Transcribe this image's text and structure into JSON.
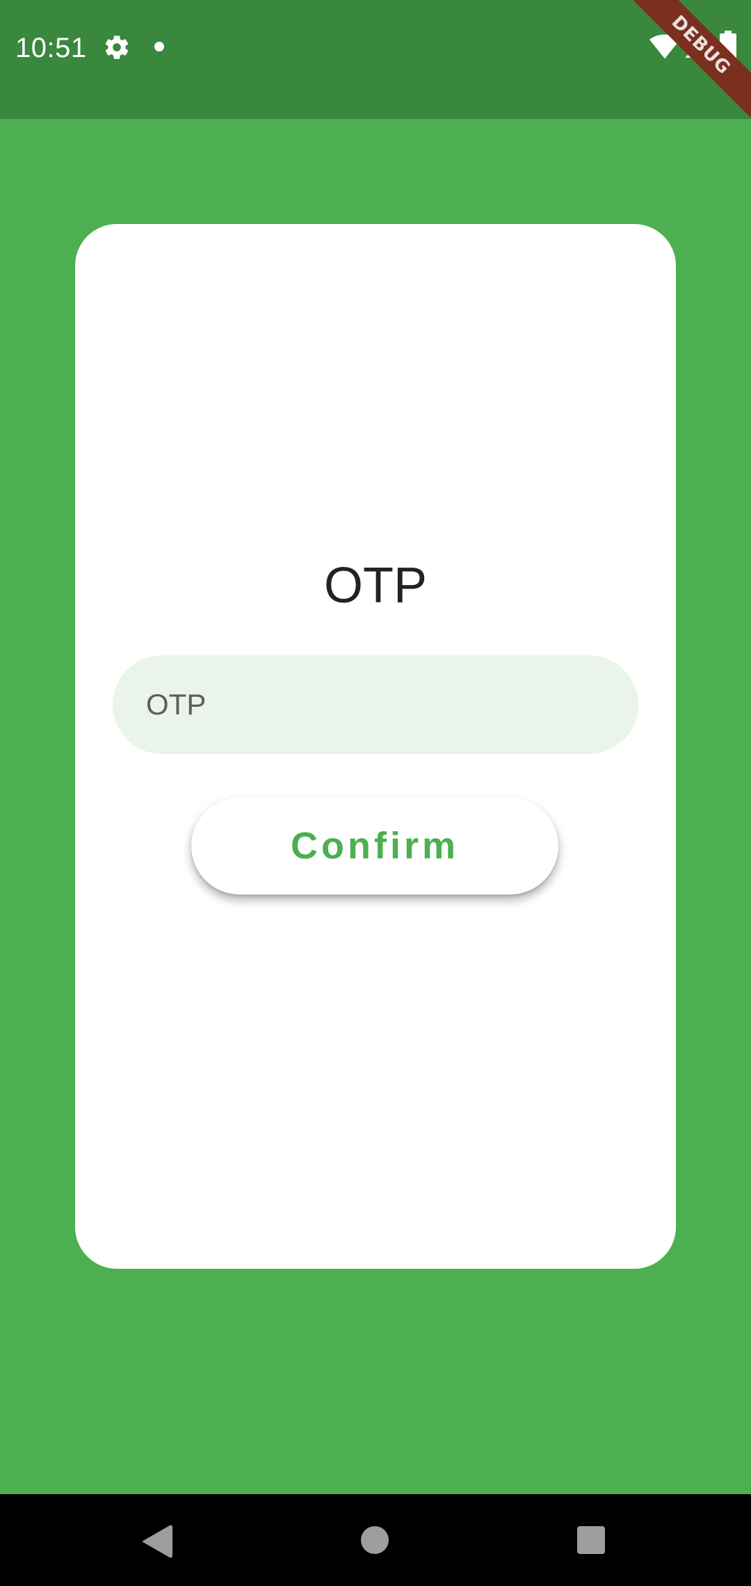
{
  "status_bar": {
    "time": "10:51",
    "icons": [
      "gear-icon",
      "notification-dot-icon",
      "wifi-icon",
      "cell-signal-icon",
      "battery-icon"
    ]
  },
  "debug_banner": {
    "label": "DEBUG"
  },
  "card": {
    "title": "OTP",
    "otp_field": {
      "placeholder": "OTP",
      "value": ""
    },
    "confirm_label": "Confirm"
  },
  "nav_bar": {
    "icons": [
      "back-icon",
      "home-icon",
      "recents-icon"
    ]
  },
  "colors": {
    "background": "#4caf50",
    "status_bar": "#3a873e",
    "card": "#ffffff",
    "input_fill": "#eaf4eb",
    "accent": "#4caf50",
    "debug_ribbon": "#7a2f1f",
    "nav_bar": "#000000"
  }
}
